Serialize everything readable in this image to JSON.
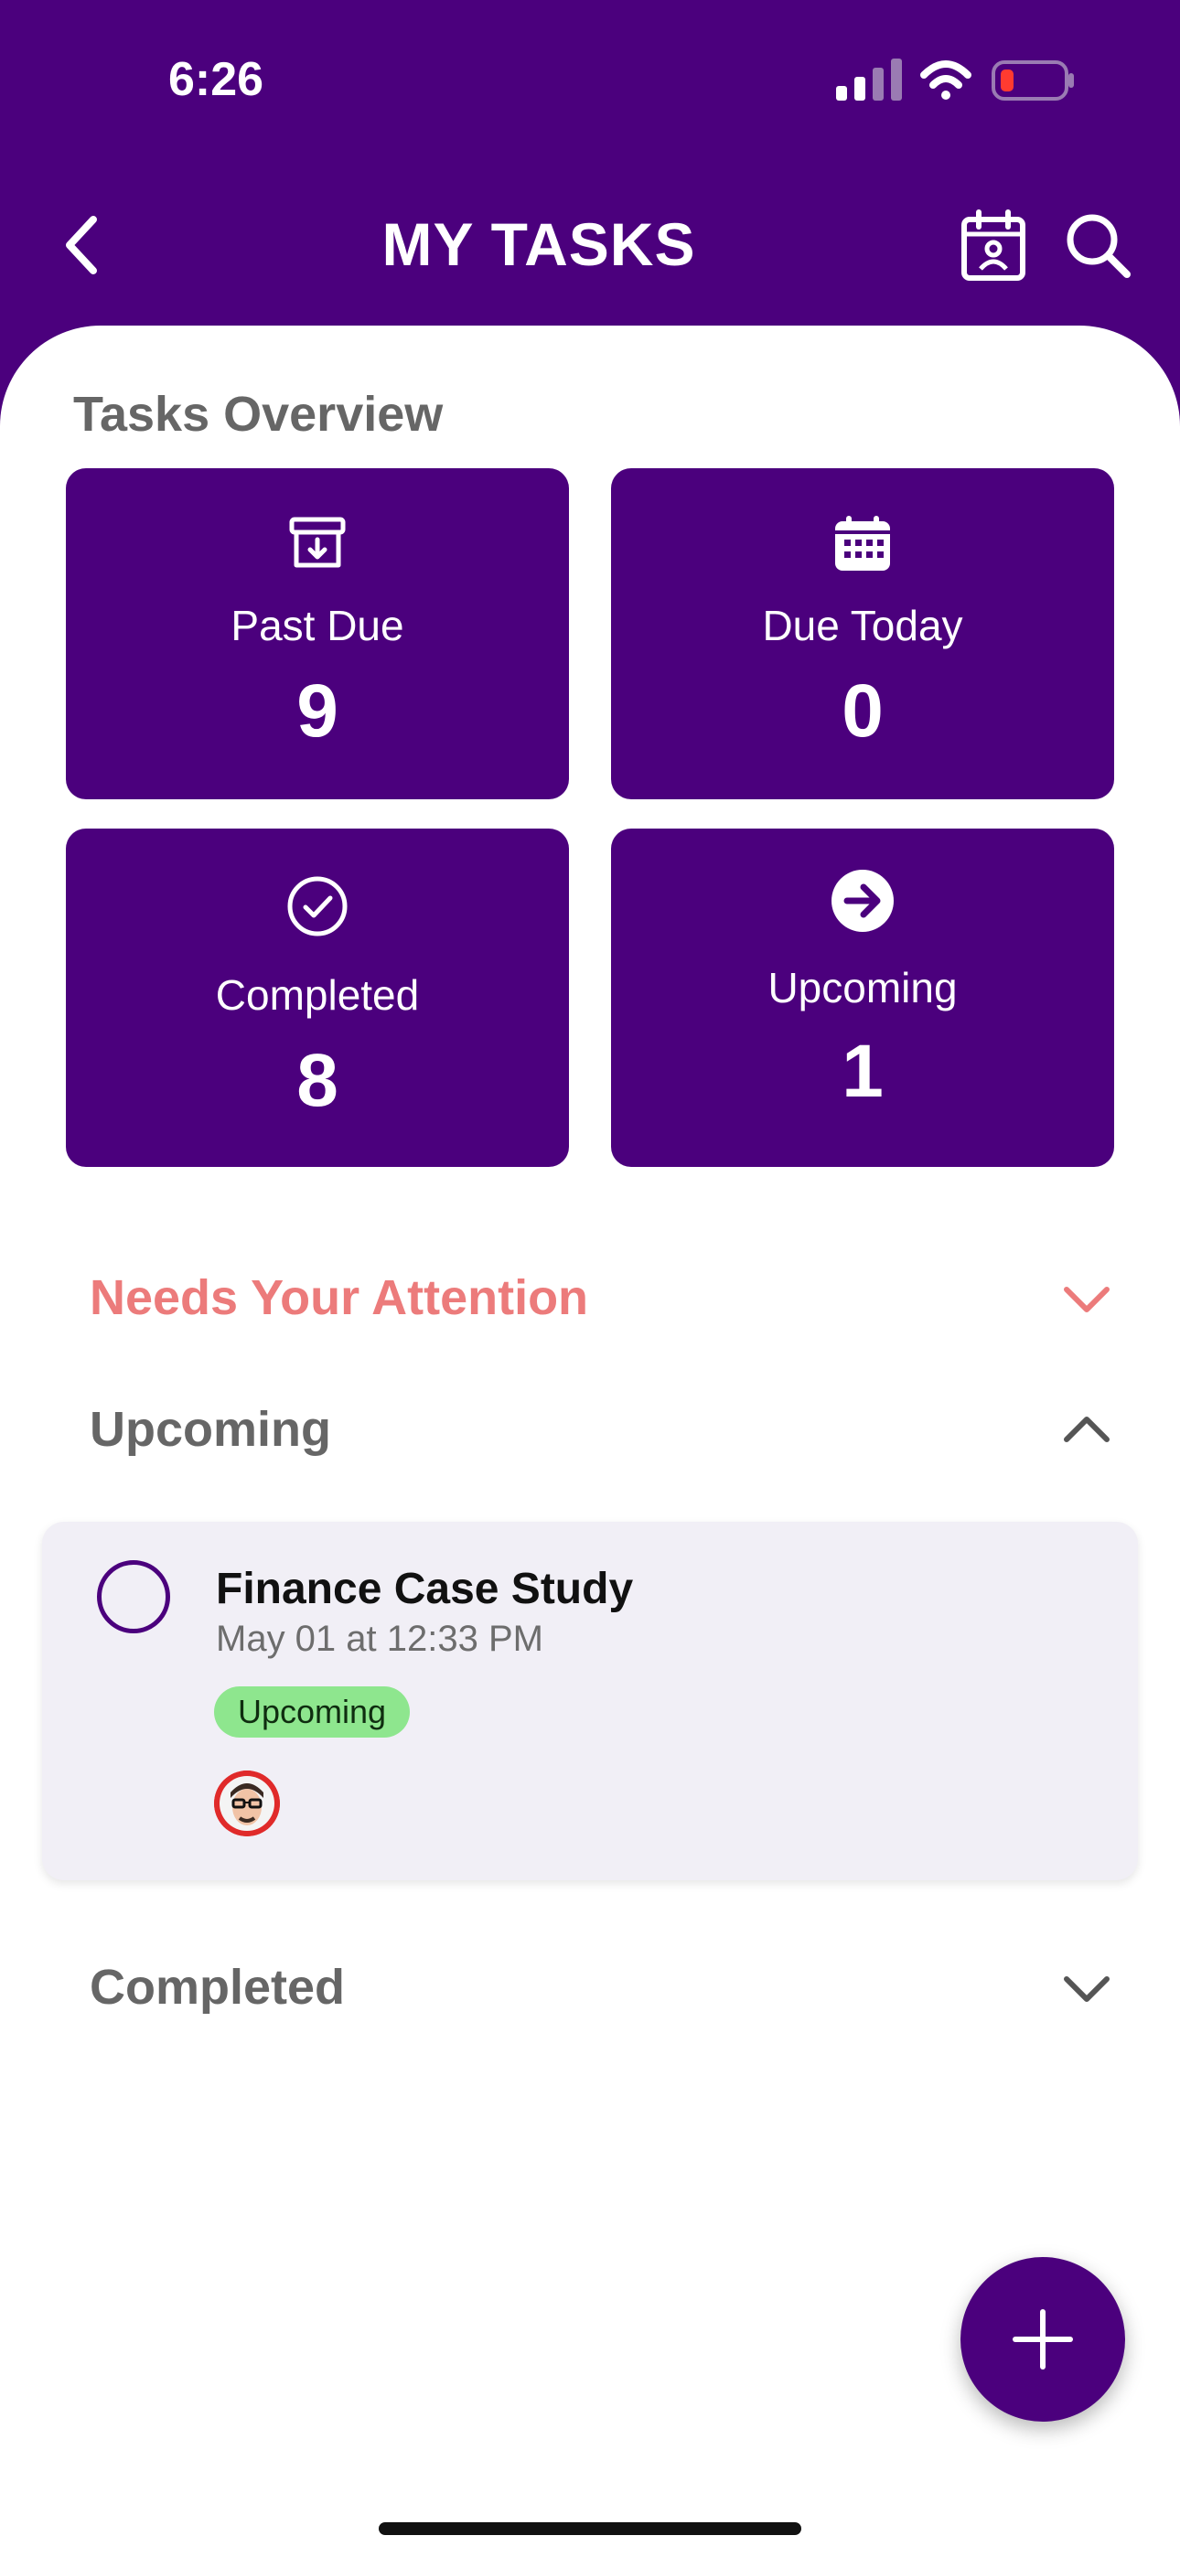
{
  "status_bar": {
    "time": "6:26"
  },
  "header": {
    "title": "MY TASKS",
    "back_icon": "chevron-left-icon",
    "calendar_icon": "calendar-contact-icon",
    "search_icon": "search-icon"
  },
  "overview": {
    "title": "Tasks Overview",
    "cards": {
      "past_due": {
        "label": "Past Due",
        "count": "9",
        "icon": "archive-download-icon"
      },
      "due_today": {
        "label": "Due Today",
        "count": "0",
        "icon": "calendar-grid-icon"
      },
      "completed": {
        "label": "Completed",
        "count": "8",
        "icon": "check-circle-icon"
      },
      "upcoming": {
        "label": "Upcoming",
        "count": "1",
        "icon": "arrow-right-circle-icon"
      }
    }
  },
  "sections": {
    "attention": {
      "label": "Needs Your Attention",
      "expanded": false
    },
    "upcoming": {
      "label": "Upcoming",
      "expanded": true
    },
    "completed": {
      "label": "Completed",
      "expanded": false
    }
  },
  "tasks": [
    {
      "title": "Finance Case Study",
      "date": "May 01 at 12:33 PM",
      "status": "Upcoming"
    }
  ],
  "colors": {
    "brand": "#4b007d",
    "attention": "#ec7b7b",
    "badge_bg": "#8ee68e",
    "task_card_bg": "#f1eff6"
  }
}
